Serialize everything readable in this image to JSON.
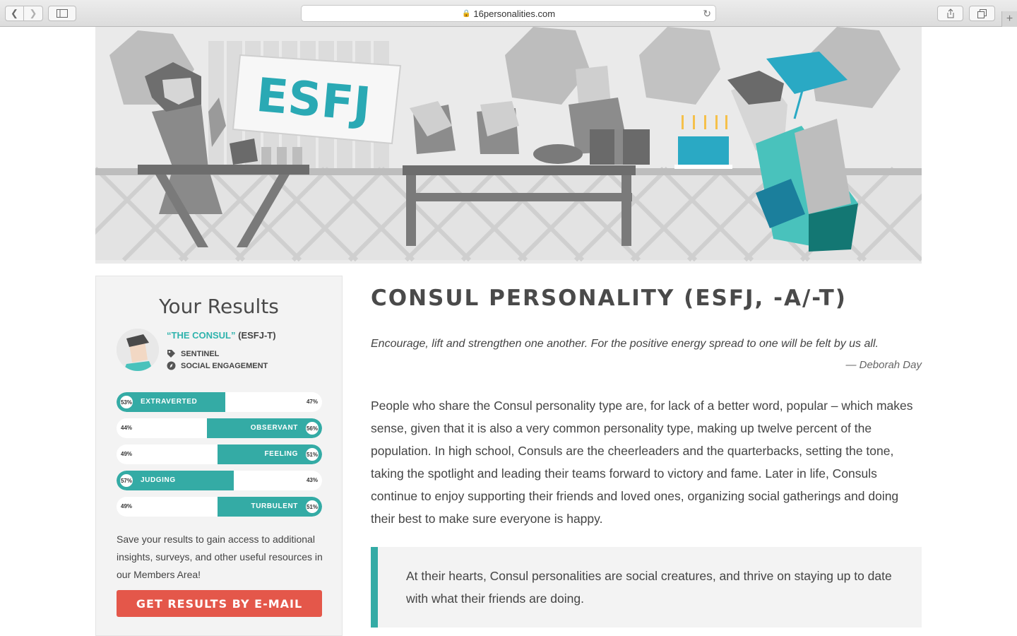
{
  "browser": {
    "url": "16personalities.com"
  },
  "hero": {
    "banner_text": "ESFJ"
  },
  "results": {
    "heading": "Your Results",
    "type_name": "“THE CONSUL”",
    "type_code": "(ESFJ-T)",
    "role": "SENTINEL",
    "strategy": "SOCIAL ENGAGEMENT",
    "traits": [
      {
        "label": "EXTRAVERTED",
        "dominant_pct": "53%",
        "other_pct": "47%",
        "dominant_value": 53,
        "side": "left"
      },
      {
        "label": "OBSERVANT",
        "dominant_pct": "56%",
        "other_pct": "44%",
        "dominant_value": 56,
        "side": "right"
      },
      {
        "label": "FEELING",
        "dominant_pct": "51%",
        "other_pct": "49%",
        "dominant_value": 51,
        "side": "right"
      },
      {
        "label": "JUDGING",
        "dominant_pct": "57%",
        "other_pct": "43%",
        "dominant_value": 57,
        "side": "left"
      },
      {
        "label": "TURBULENT",
        "dominant_pct": "51%",
        "other_pct": "49%",
        "dominant_value": 51,
        "side": "right"
      }
    ],
    "save_text": "Save your results to gain access to additional insights, surveys, and other useful resources in our Members Area!",
    "email_button": "GET RESULTS BY E-MAIL"
  },
  "article": {
    "title": "CONSUL PERSONALITY (ESFJ, -A/-T)",
    "quote": "Encourage, lift and strengthen one another. For the positive energy spread to one will be felt by us all.",
    "quote_author": "— Deborah Day",
    "paragraph": "People who share the Consul personality type are, for lack of a better word, popular – which makes sense, given that it is also a very common personality type, making up twelve percent of the population. In high school, Consuls are the cheerleaders and the quarterbacks, setting the tone, taking the spotlight and leading their teams forward to victory and fame. Later in life, Consuls continue to enjoy supporting their friends and loved ones, organizing social gatherings and doing their best to make sure everyone is happy.",
    "callout": "At their hearts, Consul personalities are social creatures, and thrive on staying up to date with what their friends are doing."
  },
  "colors": {
    "accent": "#34aba5",
    "button": "#e4574a"
  }
}
